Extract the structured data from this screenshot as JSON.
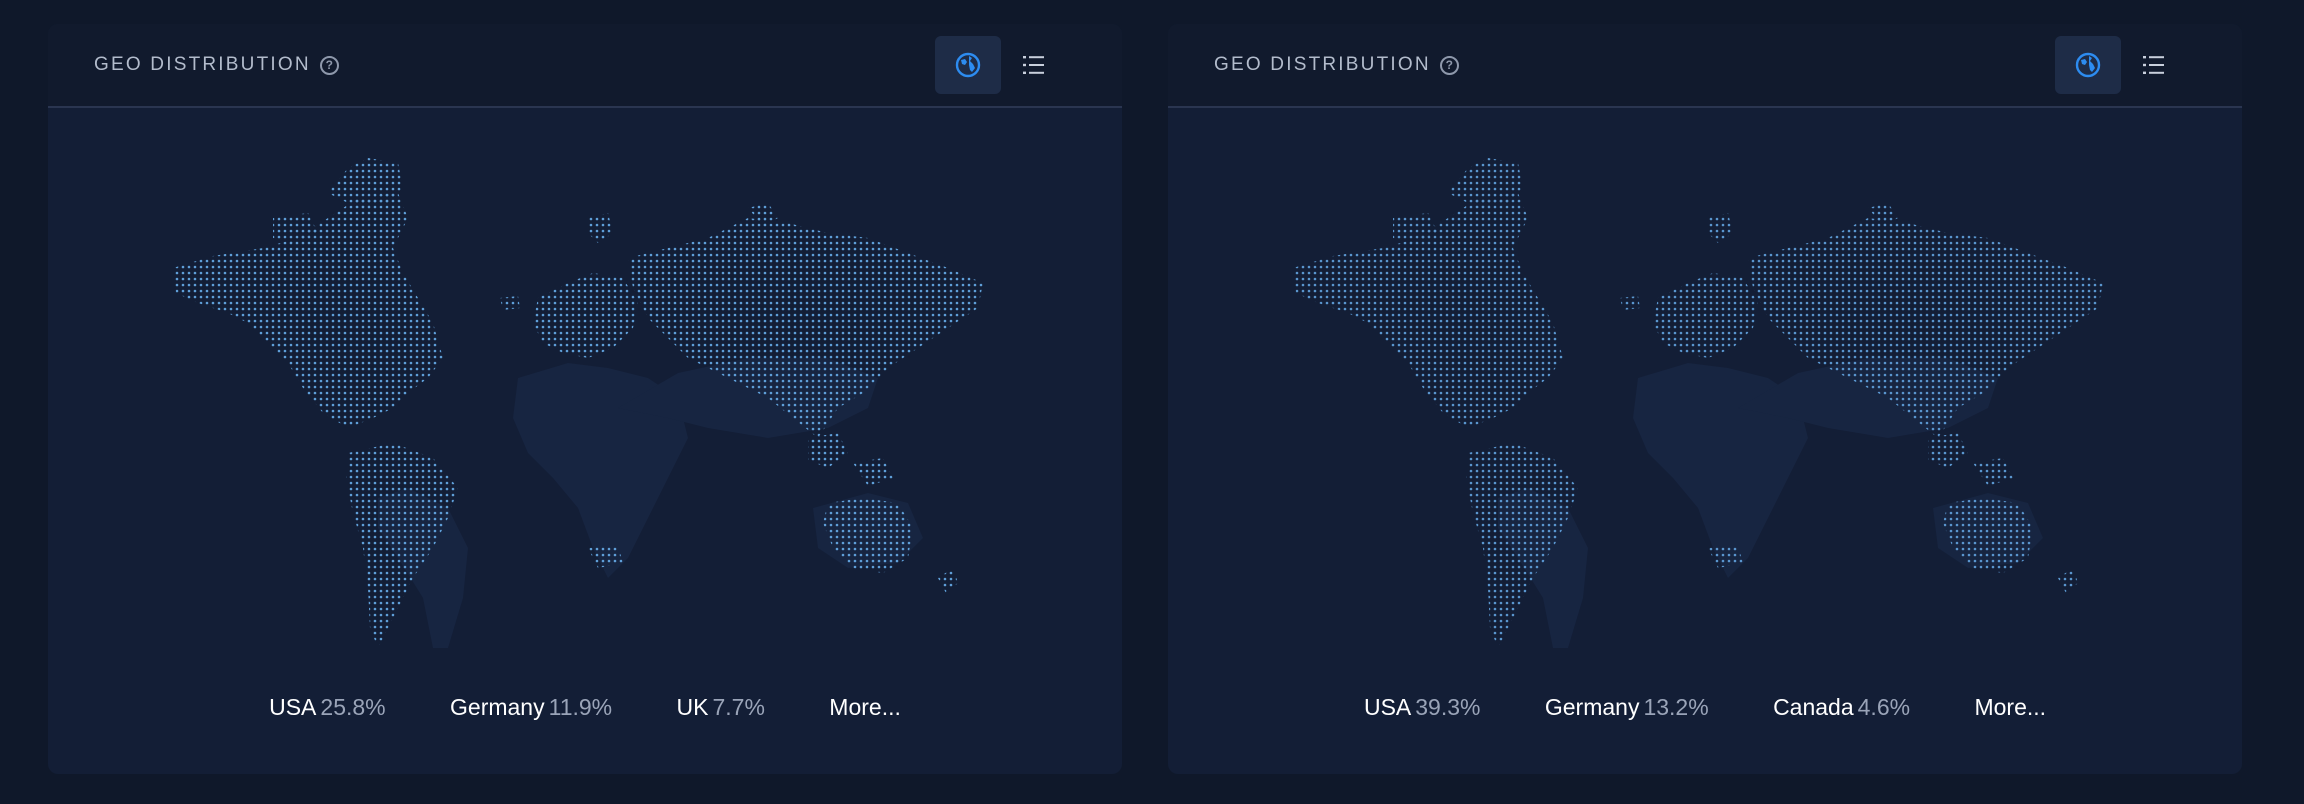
{
  "panels": [
    {
      "title": "GEO DISTRIBUTION",
      "help_icon": "question-circle-icon",
      "view_buttons": {
        "globe": "globe-icon",
        "list": "list-icon",
        "active": "globe"
      },
      "stats": [
        {
          "country": "USA",
          "pct": "25.8%"
        },
        {
          "country": "Germany",
          "pct": "11.9%"
        },
        {
          "country": "UK",
          "pct": "7.7%"
        }
      ],
      "more_label": "More..."
    },
    {
      "title": "GEO DISTRIBUTION",
      "help_icon": "question-circle-icon",
      "view_buttons": {
        "globe": "globe-icon",
        "list": "list-icon",
        "active": "globe"
      },
      "stats": [
        {
          "country": "USA",
          "pct": "39.3%"
        },
        {
          "country": "Germany",
          "pct": "13.2%"
        },
        {
          "country": "Canada",
          "pct": "4.6%"
        }
      ],
      "more_label": "More..."
    }
  ],
  "colors": {
    "page_bg": "#0f182a",
    "panel_bg": "#131e36",
    "header_bg": "#111a2d",
    "accent": "#2d8cf0",
    "dot": "#5f9fd9",
    "land": "#172541"
  }
}
